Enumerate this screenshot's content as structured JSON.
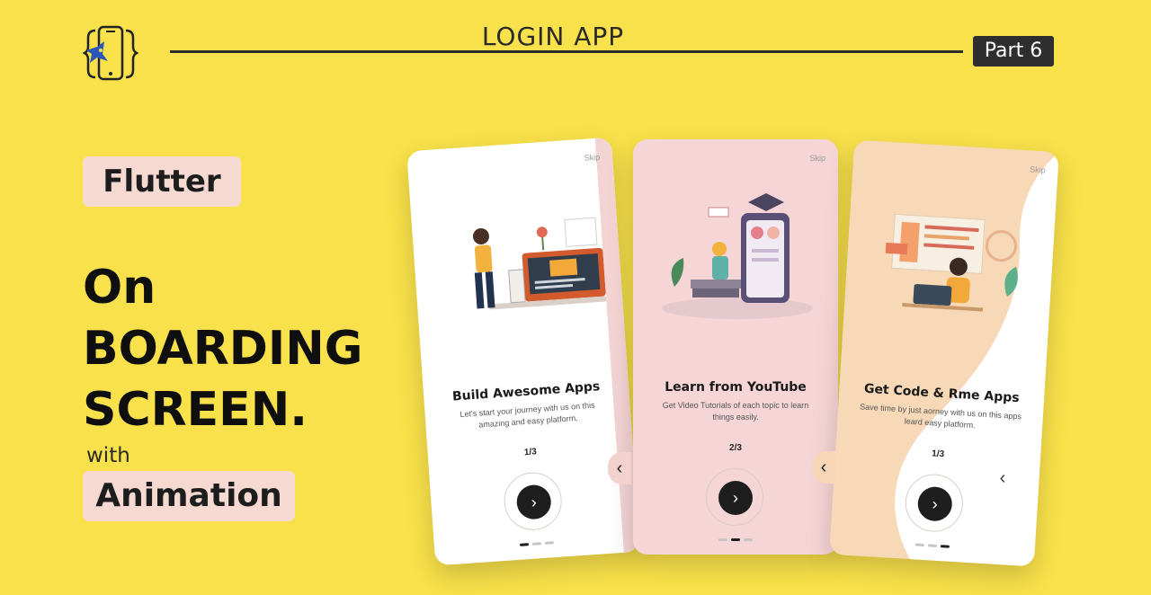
{
  "header": {
    "title": "LOGIN APP",
    "part": "Part 6"
  },
  "hero": {
    "pill_top": "Flutter",
    "line1": "On",
    "line2": "BOARDING",
    "line3": "SCREEN.",
    "with": "with",
    "pill_bottom": "Animation"
  },
  "cards": [
    {
      "skip": "Skip",
      "title": "Build Awesome Apps",
      "desc": "Let's start your journey with us on this amazing and easy platform.",
      "counter": "1/3",
      "next_icon": "chevron-right",
      "active_dot": 0
    },
    {
      "skip": "Skip",
      "title": "Learn from YouTube",
      "desc": "Get Video Tutorials of each topic to learn things easily.",
      "counter": "2/3",
      "next_icon": "chevron-right",
      "active_dot": 1
    },
    {
      "skip": "Skip",
      "title": "Get Code & Rme Apps",
      "desc": "Save time by just aorney with us on this apps leard easy platform.",
      "counter": "1/3",
      "next_icon": "chevron-right",
      "active_dot": 2
    }
  ],
  "arrows": {
    "back_icon": "chevron-left"
  },
  "colors": {
    "background": "#f8e14a",
    "pill": "#f6dad2",
    "card2": "#f6d5d6",
    "card3": "#f7d8b7",
    "button": "#1e1e1e"
  }
}
